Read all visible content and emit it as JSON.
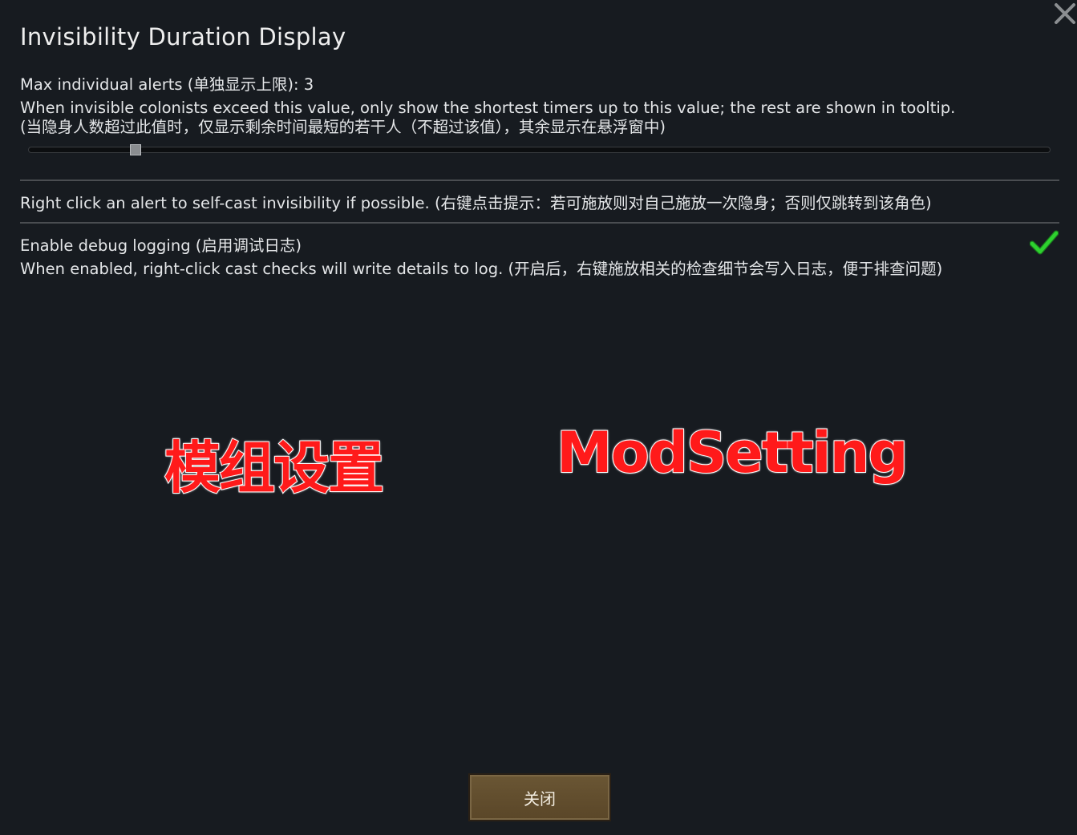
{
  "window": {
    "title": "Invisibility Duration Display"
  },
  "max_alerts": {
    "label": "Max individual alerts (单独显示上限): 3",
    "desc_line1": "When invisible colonists exceed this value, only show the shortest timers up to this value; the rest are shown in tooltip.",
    "desc_line2": "(当隐身人数超过此值时，仅显示剩余时间最短的若干人（不超过该值），其余显示在悬浮窗中)",
    "value": 3
  },
  "right_click": {
    "label": "Right click an alert to self-cast invisibility if possible. (右键点击提示：若可施放则对自己施放一次隐身；否则仅跳转到该角色)"
  },
  "debug_logging": {
    "label": "Enable debug logging (启用调试日志)",
    "desc": "When enabled, right-click cast checks will write details to log. (开启后，右键施放相关的检查细节会写入日志，便于排查问题)",
    "checked": true
  },
  "overlay": {
    "cn": "模组设置",
    "en": "ModSetting"
  },
  "footer": {
    "close_label": "关闭"
  },
  "colors": {
    "background": "#171b20",
    "check": "#27c12b",
    "button": "#5e4a2c",
    "watermark": "#ff1a1a"
  },
  "icons": {
    "close": "close-icon",
    "check": "checkmark-icon"
  }
}
